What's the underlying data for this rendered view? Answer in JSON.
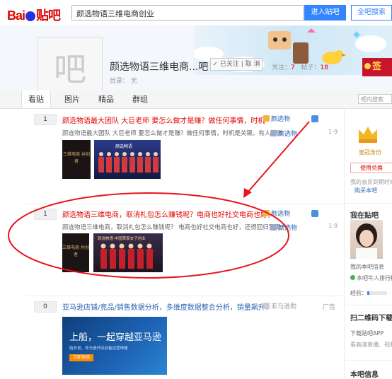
{
  "header": {
    "logo_text_1": "Bai",
    "logo_text_2": "贴吧",
    "search_value": "颜选物语三维电商创业",
    "enter_button": "进入贴吧",
    "global_search_button": "全吧搜索"
  },
  "forum": {
    "avatar_glyph": "吧",
    "title": "颜选物语三维电商...吧",
    "follow_label": "✓ 已关注 | 取 消",
    "stats_follow_label": "关注：",
    "stats_follow_value": "7",
    "stats_posts_label": "帖子：",
    "stats_posts_value": "18",
    "directory": "目录： 无",
    "sign_label": "签"
  },
  "tabs": [
    {
      "label": "看贴"
    },
    {
      "label": "图片"
    },
    {
      "label": "精品"
    },
    {
      "label": "群组"
    }
  ],
  "inner_search_placeholder": "吧内搜索",
  "threads": [
    {
      "replies": "1",
      "title": "颜选物语最大团队 大巨老师 要怎么做才是赚？做任何事情，时机",
      "abstract": "颜选物语最大团队 大巨老师 要怎么做才是赚？做任何事情，时机是关键。有人说微",
      "author": "颜选物",
      "author2": "颜选物",
      "time": "1-9",
      "thumb1_text": "三维电商 共创者",
      "thumb2_text": "颜选物语"
    },
    {
      "replies": "1",
      "title": "颜选物语三维电商，取消礼包怎么赚钱呢？电商也好社交电商也好，",
      "abstract": "颜选物语三维电商，取消礼包怎么赚钱呢？ 电商也好社交电商也好，还得回归到卖产",
      "author": "颜选物",
      "author2": "颜选物",
      "time": "1-9",
      "thumb1_text": "三维电商 共创者",
      "thumb2_text": "颜选物语·中国首家女子创业"
    },
    {
      "replies": "0",
      "title": "亚马逊店铺/竞品/销售数据分析，多维度数据整合分析，销量飙升！",
      "author": "亚马逊助",
      "ad_label": "广告",
      "ad_headline": "上船，一起穿越亚马逊",
      "ad_sub": "船长说，亚马逊开店必备运营神器",
      "ad_button": "立即体验"
    }
  ],
  "sidebar": {
    "rank_label": "皇冠身份",
    "privilege_button": "使用兑换",
    "privilege_text": "我的会员到期时间",
    "buy_text": "购买本吧",
    "my_forum_heading": "我在贴吧",
    "my_forum_info": "我的本吧信息",
    "rank_list": "本吧牛人排行榜",
    "exp_label": "经验：",
    "qr_heading": "扫二维码下载贴",
    "app_download": "下载贴吧APP",
    "app_desc": "看高清直播、视频",
    "forum_info_heading": "本吧信息"
  },
  "colors": {
    "accent_blue": "#3385ff",
    "brand_red": "#e10602",
    "link_blue": "#2d64b3",
    "annotation_red": "#e8141e"
  }
}
